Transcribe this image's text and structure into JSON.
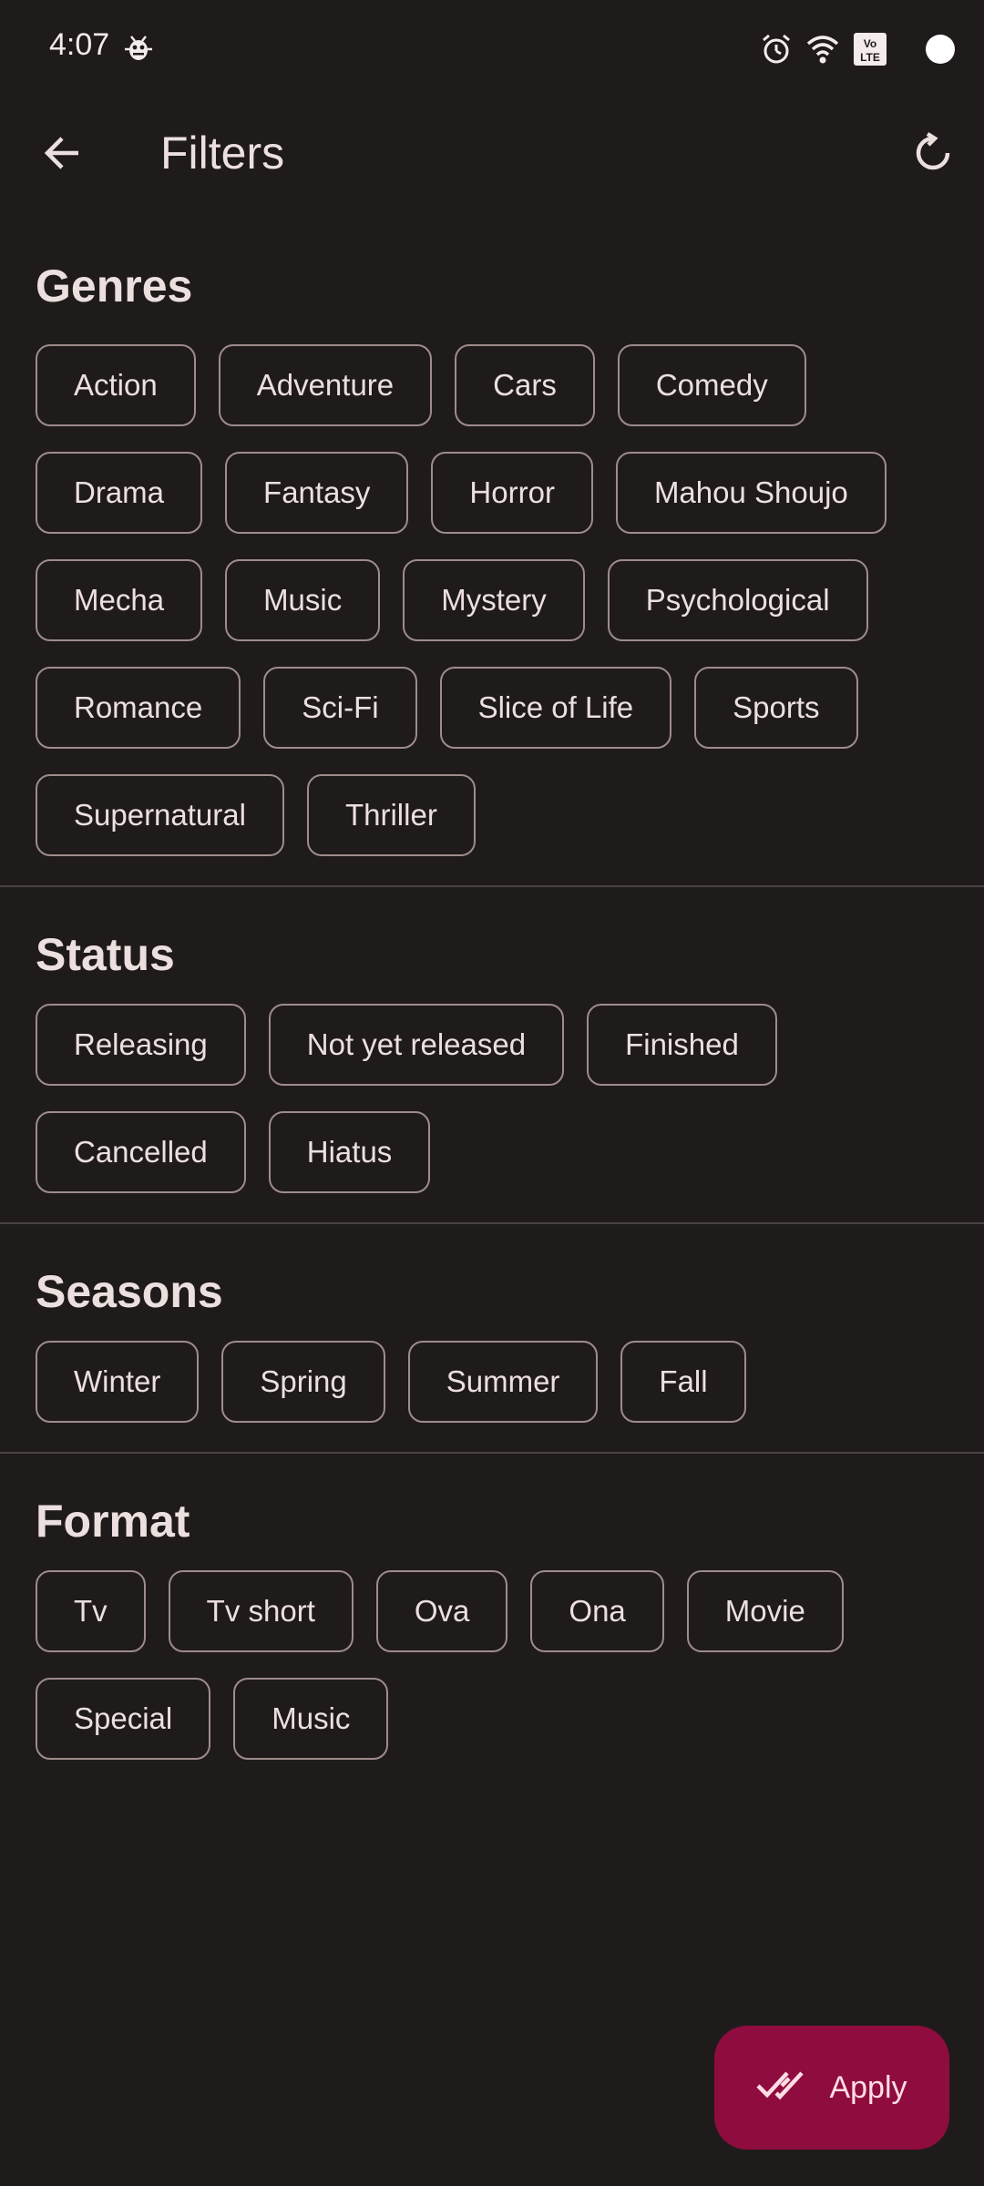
{
  "status_bar": {
    "time": "4:07",
    "icons": [
      "bug-icon",
      "alarm-icon",
      "wifi-icon",
      "volte-icon",
      "battery-icon"
    ]
  },
  "app_bar": {
    "title": "Filters",
    "back_icon": "arrow-back-icon",
    "reset_icon": "refresh-icon"
  },
  "sections": {
    "genres": {
      "title": "Genres",
      "chips": [
        "Action",
        "Adventure",
        "Cars",
        "Comedy",
        "Drama",
        "Fantasy",
        "Horror",
        "Mahou Shoujo",
        "Mecha",
        "Music",
        "Mystery",
        "Psychological",
        "Romance",
        "Sci-Fi",
        "Slice of Life",
        "Sports",
        "Supernatural",
        "Thriller"
      ]
    },
    "status": {
      "title": "Status",
      "chips": [
        "Releasing",
        "Not yet released",
        "Finished",
        "Cancelled",
        "Hiatus"
      ]
    },
    "seasons": {
      "title": "Seasons",
      "chips": [
        "Winter",
        "Spring",
        "Summer",
        "Fall"
      ]
    },
    "format": {
      "title": "Format",
      "chips": [
        "Tv",
        "Tv short",
        "Ova",
        "Ona",
        "Movie",
        "Special",
        "Music"
      ]
    }
  },
  "apply_button": {
    "label": "Apply",
    "icon": "done-all-icon"
  },
  "colors": {
    "background": "#1f1b1b",
    "text": "#ece0df",
    "chip_border": "#9e8c8b",
    "divider": "#4a4343",
    "fab_background": "#8f0c3f",
    "fab_text": "#ffdde4"
  }
}
